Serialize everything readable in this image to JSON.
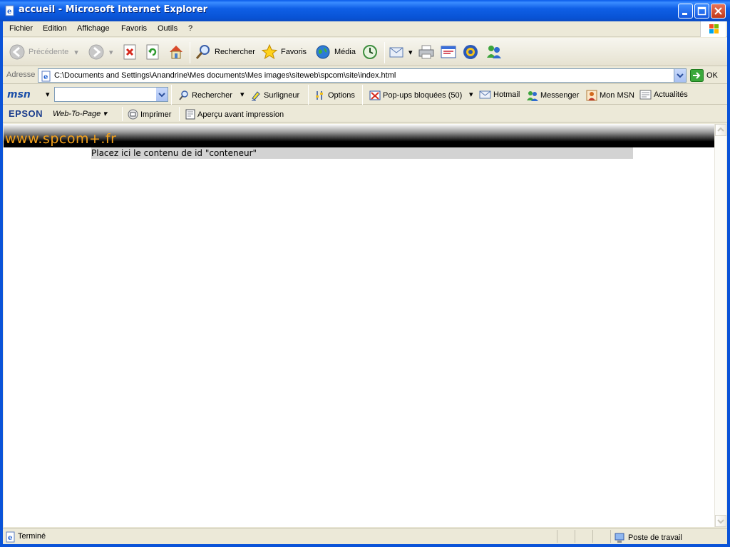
{
  "window": {
    "title": "accueil - Microsoft Internet Explorer"
  },
  "menu": {
    "items": [
      "Fichier",
      "Edition",
      "Affichage",
      "Favoris",
      "Outils",
      "?"
    ]
  },
  "toolbar": {
    "back_label": "Précédente",
    "search_label": "Rechercher",
    "favorites_label": "Favoris",
    "media_label": "Média"
  },
  "address": {
    "label": "Adresse",
    "value": "C:\\Documents and Settings\\Anandrine\\Mes documents\\Mes images\\siteweb\\spcom\\site\\index.html",
    "go_label": "OK"
  },
  "msn": {
    "logo": "msn",
    "search_value": "",
    "search_label": "Rechercher",
    "highlight_label": "Surligneur",
    "options_label": "Options",
    "popups_label": "Pop-ups bloquées (50)",
    "hotmail_label": "Hotmail",
    "messenger_label": "Messenger",
    "mymsn_label": "Mon MSN",
    "news_label": "Actualités"
  },
  "epson": {
    "logo": "EPSON",
    "webtopage_label": "Web-To-Page",
    "print_label": "Imprimer",
    "preview_label": "Aperçu avant impression"
  },
  "page": {
    "banner_text": "www.spcom+.fr",
    "conteneur_text": "Placez ici le contenu de id \"conteneur\""
  },
  "status": {
    "text": "Terminé",
    "zone": "Poste de travail"
  },
  "colors": {
    "titlebar": "#0A5BEA",
    "banner_text": "#F5A21B",
    "conteneur_bg": "#D3D3D3"
  }
}
